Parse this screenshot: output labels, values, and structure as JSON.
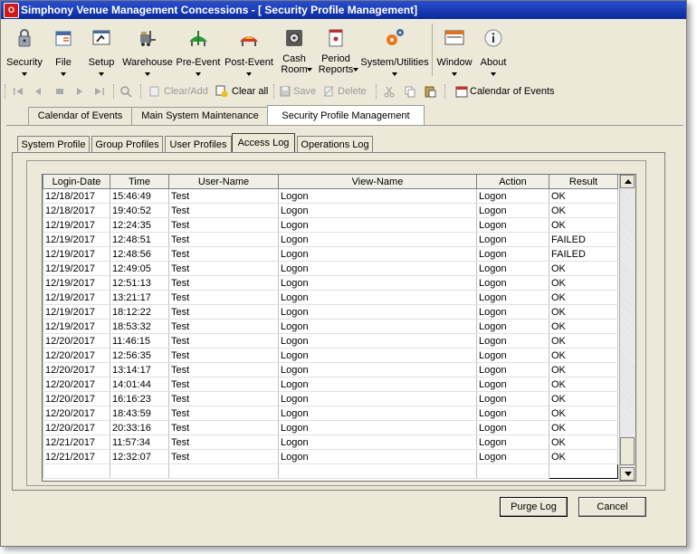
{
  "window": {
    "title": "Simphony Venue Management Concessions - [  Security Profile Management]",
    "app_icon": "oracle-app-icon"
  },
  "menu": [
    {
      "label": "Security",
      "icon": "lock-icon"
    },
    {
      "label": "File",
      "icon": "folder-icon"
    },
    {
      "label": "Setup",
      "icon": "setup-icon"
    },
    {
      "label": "Warehouse",
      "icon": "forklift-icon"
    },
    {
      "label": "Pre-Event",
      "icon": "tent-icon"
    },
    {
      "label": "Post-Event",
      "icon": "tent-icon"
    },
    {
      "label": "Cash Room",
      "label1": "Cash",
      "label2": "Room",
      "icon": "safe-icon"
    },
    {
      "label": "Period Reports",
      "label1": "Period",
      "label2": "Reports",
      "icon": "report-icon"
    },
    {
      "label": "System/Utilities",
      "icon": "gears-icon"
    },
    {
      "label": "Window",
      "icon": "window-icon"
    },
    {
      "label": "About",
      "icon": "info-icon"
    }
  ],
  "toolbar": {
    "clear_add": "Clear/Add",
    "clear_all": "Clear all",
    "save": "Save",
    "delete": "Delete",
    "calendar": "Calendar of Events"
  },
  "outer_tabs": [
    "Calendar of Events",
    "Main System Maintenance",
    "Security Profile Management"
  ],
  "inner_tabs": [
    "System Profile",
    "Group Profiles",
    "User Profiles",
    "Access Log",
    "Operations Log"
  ],
  "table": {
    "columns": [
      "Login-Date",
      "Time",
      "User-Name",
      "View-Name",
      "Action",
      "Result"
    ],
    "rows": [
      [
        "12/18/2017",
        "15:46:49",
        "Test",
        "Logon",
        "Logon",
        "OK"
      ],
      [
        "12/18/2017",
        "19:40:52",
        "Test",
        "Logon",
        "Logon",
        "OK"
      ],
      [
        "12/19/2017",
        "12:24:35",
        "Test",
        "Logon",
        "Logon",
        "OK"
      ],
      [
        "12/19/2017",
        "12:48:51",
        "Test",
        "Logon",
        "Logon",
        "FAILED"
      ],
      [
        "12/19/2017",
        "12:48:56",
        "Test",
        "Logon",
        "Logon",
        "FAILED"
      ],
      [
        "12/19/2017",
        "12:49:05",
        "Test",
        "Logon",
        "Logon",
        "OK"
      ],
      [
        "12/19/2017",
        "12:51:13",
        "Test",
        "Logon",
        "Logon",
        "OK"
      ],
      [
        "12/19/2017",
        "13:21:17",
        "Test",
        "Logon",
        "Logon",
        "OK"
      ],
      [
        "12/19/2017",
        "18:12:22",
        "Test",
        "Logon",
        "Logon",
        "OK"
      ],
      [
        "12/19/2017",
        "18:53:32",
        "Test",
        "Logon",
        "Logon",
        "OK"
      ],
      [
        "12/20/2017",
        "11:46:15",
        "Test",
        "Logon",
        "Logon",
        "OK"
      ],
      [
        "12/20/2017",
        "12:56:35",
        "Test",
        "Logon",
        "Logon",
        "OK"
      ],
      [
        "12/20/2017",
        "13:14:17",
        "Test",
        "Logon",
        "Logon",
        "OK"
      ],
      [
        "12/20/2017",
        "14:01:44",
        "Test",
        "Logon",
        "Logon",
        "OK"
      ],
      [
        "12/20/2017",
        "16:16:23",
        "Test",
        "Logon",
        "Logon",
        "OK"
      ],
      [
        "12/20/2017",
        "18:43:59",
        "Test",
        "Logon",
        "Logon",
        "OK"
      ],
      [
        "12/20/2017",
        "20:33:16",
        "Test",
        "Logon",
        "Logon",
        "OK"
      ],
      [
        "12/21/2017",
        "11:57:34",
        "Test",
        "Logon",
        "Logon",
        "OK"
      ],
      [
        "12/21/2017",
        "12:32:07",
        "Test",
        "Logon",
        "Logon",
        "OK"
      ],
      [
        "",
        "",
        "",
        "",
        "",
        ""
      ]
    ]
  },
  "buttons": {
    "purge": "Purge Log",
    "cancel": "Cancel"
  },
  "colors": {
    "titlebar": "#0a2a9a",
    "accent_red": "#d01818",
    "window_bg": "#ece9d8"
  }
}
